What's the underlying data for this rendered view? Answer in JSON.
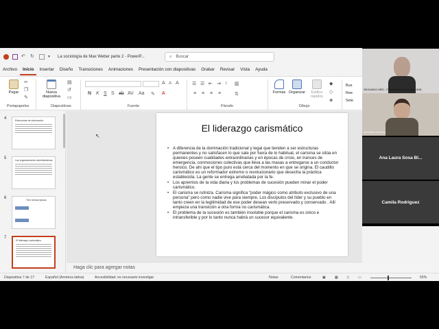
{
  "window": {
    "title": "La sociología de Max Weber parte 2  -  PowerP..."
  },
  "search": {
    "placeholder": "Buscar"
  },
  "menu": {
    "tabs": [
      "Archivo",
      "Inicio",
      "Insertar",
      "Diseño",
      "Transiciones",
      "Animaciones",
      "Presentación con diapositivas",
      "Grabar",
      "Revisar",
      "Vista",
      "Ayuda"
    ]
  },
  "ribbon": {
    "pegar": "Pegar",
    "nueva": "Nueva diapositiva",
    "formas": "Formas",
    "organizar": "Organizar",
    "estilos": "Estilos rápidos",
    "groups": {
      "portapapeles": "Portapapeles",
      "diapositivas": "Diapositivas",
      "fuente": "Fuente",
      "parrafo": "Párrafo",
      "dibujo": "Dibujo"
    },
    "right": [
      "Bus",
      "Ree",
      "Sele"
    ]
  },
  "thumbnails": [
    {
      "num": "4",
      "title": "Estructuras de dominación"
    },
    {
      "num": "5",
      "title": "Las organizaciones administrativas"
    },
    {
      "num": "6",
      "title": "Tres formas típicas"
    },
    {
      "num": "7",
      "title": "El liderazgo carismático"
    }
  ],
  "slide": {
    "title": "El liderazgo carismático",
    "bullets": [
      "A diferencia de la dominación tradicional y legal que tienden a ser estructuras permanentes y no satisfacen lo que sale por fuera de lo habitual, el carisma se sitúa en quienes poseen cualidades extraordinarias y en épocas de crisis, en trances de emergencia, conmociones colectivas que lleva a las masas a entregarse a un conductor heroico. De ahí que el tipo puro está cerca del momento en que se origina. El caudillo carismático es un reformador extremo o revolucionario que desecha la práctica establecida. La gente se entrega arrebatada por la fe.",
      "Los apremios de la vida diaria y los problemas de sucesión pueden minar el poder carismático.",
      "El carisma se rutiniza. Carisma significa “poder mágico como atributo exclusivo de una persona” pero como nadie vive para siempre, Los discípulos del líder y su pueblo en tanto creen en la legitimidad de ese poder desean verlo preservado y conservado . Allí empieza una transición a otra forma no carismática.",
      "El problema de la sucesión es también insoluble porque el carisma es único e intransferible y por lo tanto nunca habrá un sucesor equivalente."
    ]
  },
  "notes": {
    "placeholder": "Haga clic para agregar notas"
  },
  "status": {
    "slide": "Diapositiva 7 de 17",
    "language": "Español (América latina)",
    "accessibility": "Accesibilidad: es necesario investigar",
    "notes": "Notas",
    "comments": "Comentarios",
    "zoom": "55%"
  },
  "participants": [
    {
      "label": "SEGUNDO AÑO - Facultad de Psicología UNSL"
    },
    {
      "label": "Jeremías Coertos"
    },
    {
      "label": "Ana Laura Sosa Bl..."
    },
    {
      "label": "Camila Rodriguez"
    }
  ],
  "colors": {
    "accent": "#c43e1c",
    "tile": "#3a3a3a"
  }
}
